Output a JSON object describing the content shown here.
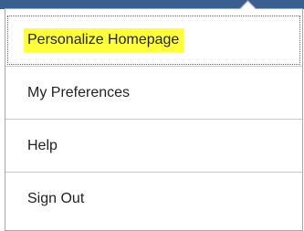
{
  "menu": {
    "highlight_color": "#ffff3a",
    "items": [
      {
        "label": "Personalize Homepage",
        "highlighted": true
      },
      {
        "label": "My Preferences"
      },
      {
        "label": "Help"
      },
      {
        "label": "Sign Out"
      }
    ]
  }
}
